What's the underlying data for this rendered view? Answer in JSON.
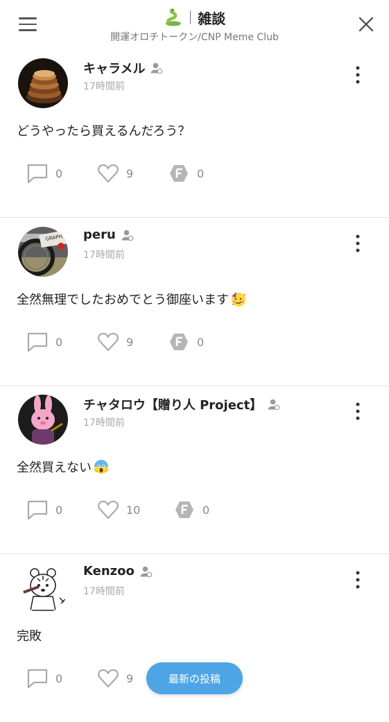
{
  "header": {
    "title": "雑談",
    "subtitle": "開運オロチトークン/CNP Meme Club",
    "logo_icon": "snake-icon",
    "menu_icon": "hamburger-icon",
    "close_icon": "close-icon"
  },
  "posts": [
    {
      "author": "キャラメル",
      "time": "17時間前",
      "text": "どうやったら買えるんだろう？",
      "emoji": "",
      "comments": "0",
      "likes": "9",
      "tokens": "0"
    },
    {
      "author": "peru",
      "time": "17時間前",
      "text": "全然無理でしたおめでとう御座います",
      "emoji": "partying-face",
      "comments": "0",
      "likes": "9",
      "tokens": "0"
    },
    {
      "author": "チャタロウ【贈り人 Project】",
      "time": "17時間前",
      "text": "全然買えない",
      "emoji": "screaming-face",
      "comments": "0",
      "likes": "10",
      "tokens": "0"
    },
    {
      "author": "Kenzoo",
      "time": "17時間前",
      "text": "完敗",
      "emoji": "",
      "comments": "0",
      "likes": "9",
      "tokens": ""
    }
  ],
  "latest_button": "最新の投稿",
  "colors": {
    "accent": "#4ea5e6",
    "divider": "#e2e2e2",
    "muted": "#888888"
  }
}
